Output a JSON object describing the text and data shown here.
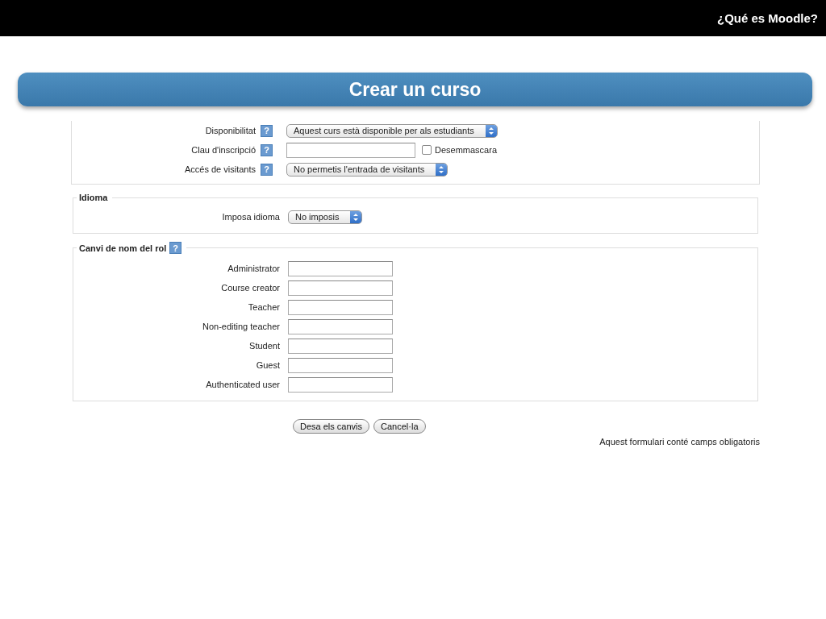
{
  "header": {
    "title": "¿Qué es Moodle?"
  },
  "banner": {
    "title": "Crear un curso"
  },
  "sections": [
    {
      "cut_top": true,
      "rows": [
        {
          "kind": "select",
          "label": "Disponibilitat",
          "help": "?",
          "value": "Aquest curs està disponible per als estudiants"
        },
        {
          "kind": "password",
          "label": "Clau d'inscripció",
          "help": "?",
          "checkbox": {
            "label": "Desemmascara",
            "checked": false
          }
        },
        {
          "kind": "select",
          "label": "Accés de visitants",
          "help": "?",
          "value": "No permetis l'entrada de visitants"
        }
      ]
    },
    {
      "legend": "Idioma",
      "rows": [
        {
          "kind": "select",
          "label": "Imposa idioma",
          "value": "No imposis"
        }
      ]
    },
    {
      "legend": "Canvi de nom del rol",
      "legend_help": "?",
      "rows": [
        {
          "kind": "text",
          "label": "Administrator"
        },
        {
          "kind": "text",
          "label": "Course creator"
        },
        {
          "kind": "text",
          "label": "Teacher"
        },
        {
          "kind": "text",
          "label": "Non-editing teacher"
        },
        {
          "kind": "text",
          "label": "Student"
        },
        {
          "kind": "text",
          "label": "Guest"
        },
        {
          "kind": "text",
          "label": "Authenticated user"
        }
      ]
    }
  ],
  "buttons": [
    "Desa els canvis",
    "Cancel·la"
  ],
  "note": "Aquest formulari conté camps obligatoris"
}
